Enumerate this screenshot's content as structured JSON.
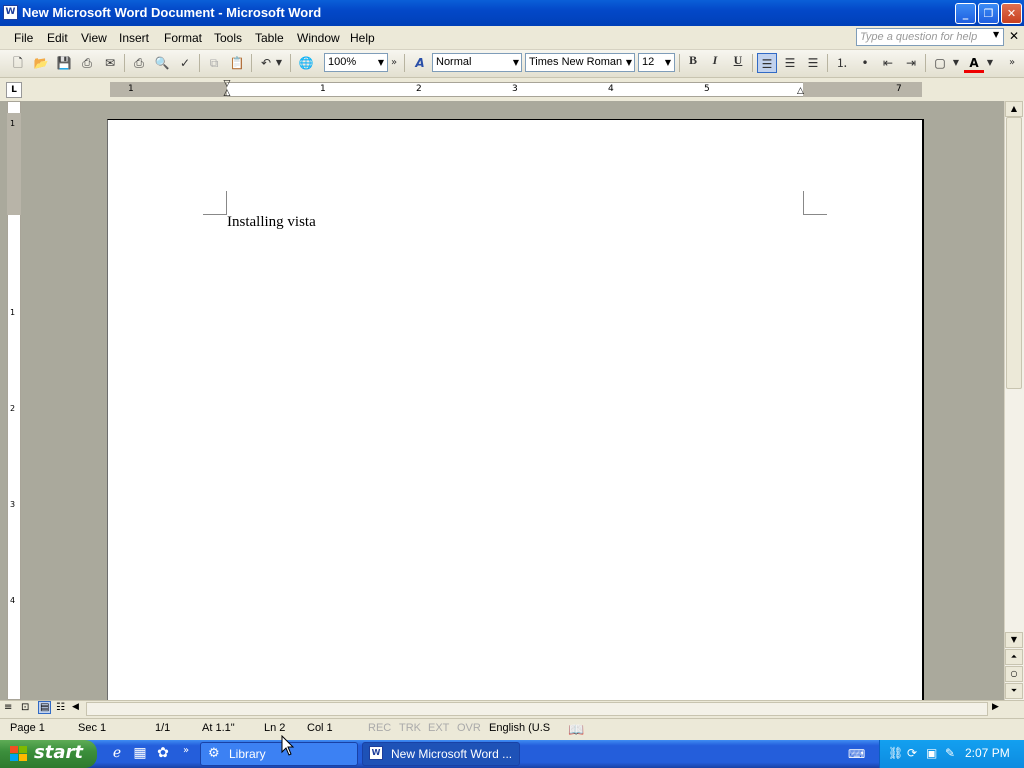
{
  "window": {
    "title": "New Microsoft Word Document - Microsoft Word",
    "minimize": "_",
    "restore": "❐",
    "close": "✕"
  },
  "menu": [
    "File",
    "Edit",
    "View",
    "Insert",
    "Format",
    "Tools",
    "Table",
    "Window",
    "Help"
  ],
  "help_box": {
    "placeholder": "Type a question for help"
  },
  "toolbar": {
    "zoom": "100%",
    "style": "Normal",
    "font": "Times New Roman",
    "font_size": "12",
    "bold": "B",
    "italic": "I",
    "underline": "U"
  },
  "ruler": {
    "h_numbers": [
      "1",
      "1",
      "2",
      "3",
      "4",
      "5",
      "6",
      "7"
    ],
    "v_numbers": [
      "1",
      "1",
      "2",
      "3",
      "4"
    ],
    "tab_selector": "L"
  },
  "document": {
    "text": "Installing vista"
  },
  "statusbar": {
    "page": "Page  1",
    "sec": "Sec  1",
    "pages": "1/1",
    "at": "At  1.1\"",
    "ln": "Ln  2",
    "col": "Col  1",
    "rec": "REC",
    "trk": "TRK",
    "ext": "EXT",
    "ovr": "OVR",
    "language": "English (U.S"
  },
  "taskbar": {
    "start": "start",
    "tasks": [
      "Library",
      "New Microsoft Word ..."
    ],
    "clock": "2:07 PM"
  },
  "colors": {
    "titlebar": "#0348c8",
    "taskbar": "#245edb",
    "start": "#3c8f3c",
    "doc_bg": "#aaa99c"
  }
}
